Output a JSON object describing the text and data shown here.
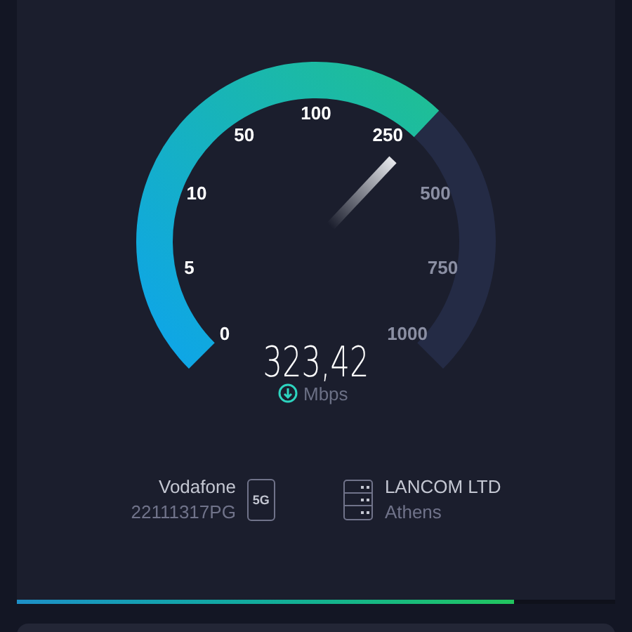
{
  "gauge": {
    "ticks": [
      {
        "label": "0",
        "reached": true
      },
      {
        "label": "5",
        "reached": true
      },
      {
        "label": "10",
        "reached": true
      },
      {
        "label": "50",
        "reached": true
      },
      {
        "label": "100",
        "reached": true
      },
      {
        "label": "250",
        "reached": true
      },
      {
        "label": "500",
        "reached": false
      },
      {
        "label": "750",
        "reached": false
      },
      {
        "label": "1000",
        "reached": false
      }
    ],
    "value": "323,42",
    "unit": "Mbps"
  },
  "provider": {
    "name": "Vodafone",
    "id": "22111317PG",
    "network": "5G"
  },
  "server": {
    "name": "LANCOM LTD",
    "city": "Athens"
  },
  "progress": {
    "level": 0.83
  }
}
